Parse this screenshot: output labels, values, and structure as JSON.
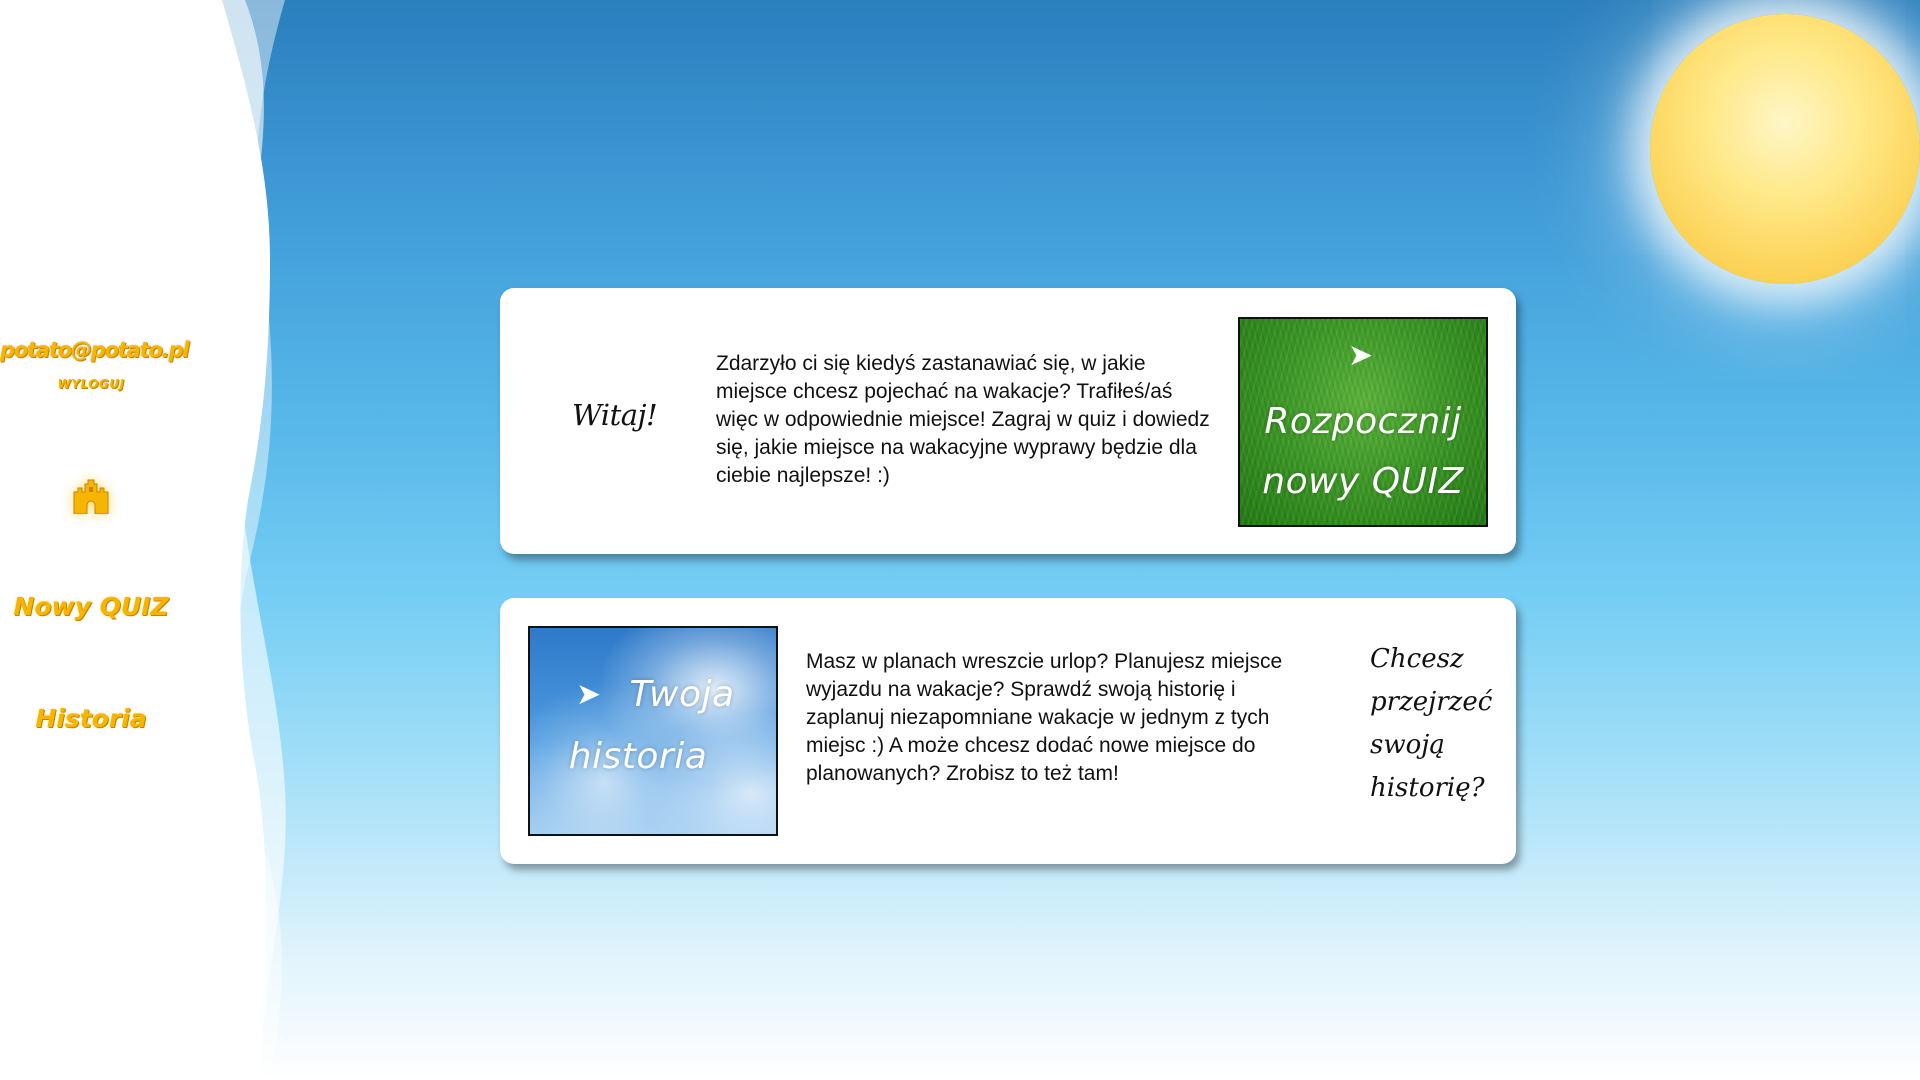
{
  "sidebar": {
    "user_email": "potato@potato.pl",
    "logout_label": "WYLOGUJ",
    "home_icon": "castle-icon",
    "nav": {
      "new_quiz": "Nowy QUIZ",
      "history": "Historia"
    }
  },
  "cards": {
    "welcome": {
      "greeting": "Witaj!",
      "text": "Zdarzyło ci się kiedyś zastanawiać się, w jakie miejsce chcesz pojechać na wakacje? Trafiłeś/aś więc w odpowiednie miejsce! Zagraj w quiz i dowiedz się, jakie miejsce na wakacyjne wyprawy będzie dla ciebie najlepsze! :)",
      "tile": {
        "arrow": "➤",
        "line1": "Rozpocznij",
        "line2": "nowy QUIZ"
      }
    },
    "history": {
      "text": "Masz w planach wreszcie urlop? Planujesz miejsce wyjazdu na wakacje? Sprawdź swoją historię i zaplanuj niezapomniane wakacje w jednym z tych miejsc :) A może chcesz dodać nowe miejsce do planowanych? Zrobisz to też tam!",
      "tile": {
        "arrow": "➤",
        "line1": "Twoja",
        "line2": "historia"
      },
      "question": "Chcesz przejrzeć swoją historię?"
    }
  },
  "colors": {
    "accent": "#f7b500",
    "card_bg": "#ffffff",
    "sky_top": "#2a7fbd",
    "sun": "#fcd45a"
  }
}
